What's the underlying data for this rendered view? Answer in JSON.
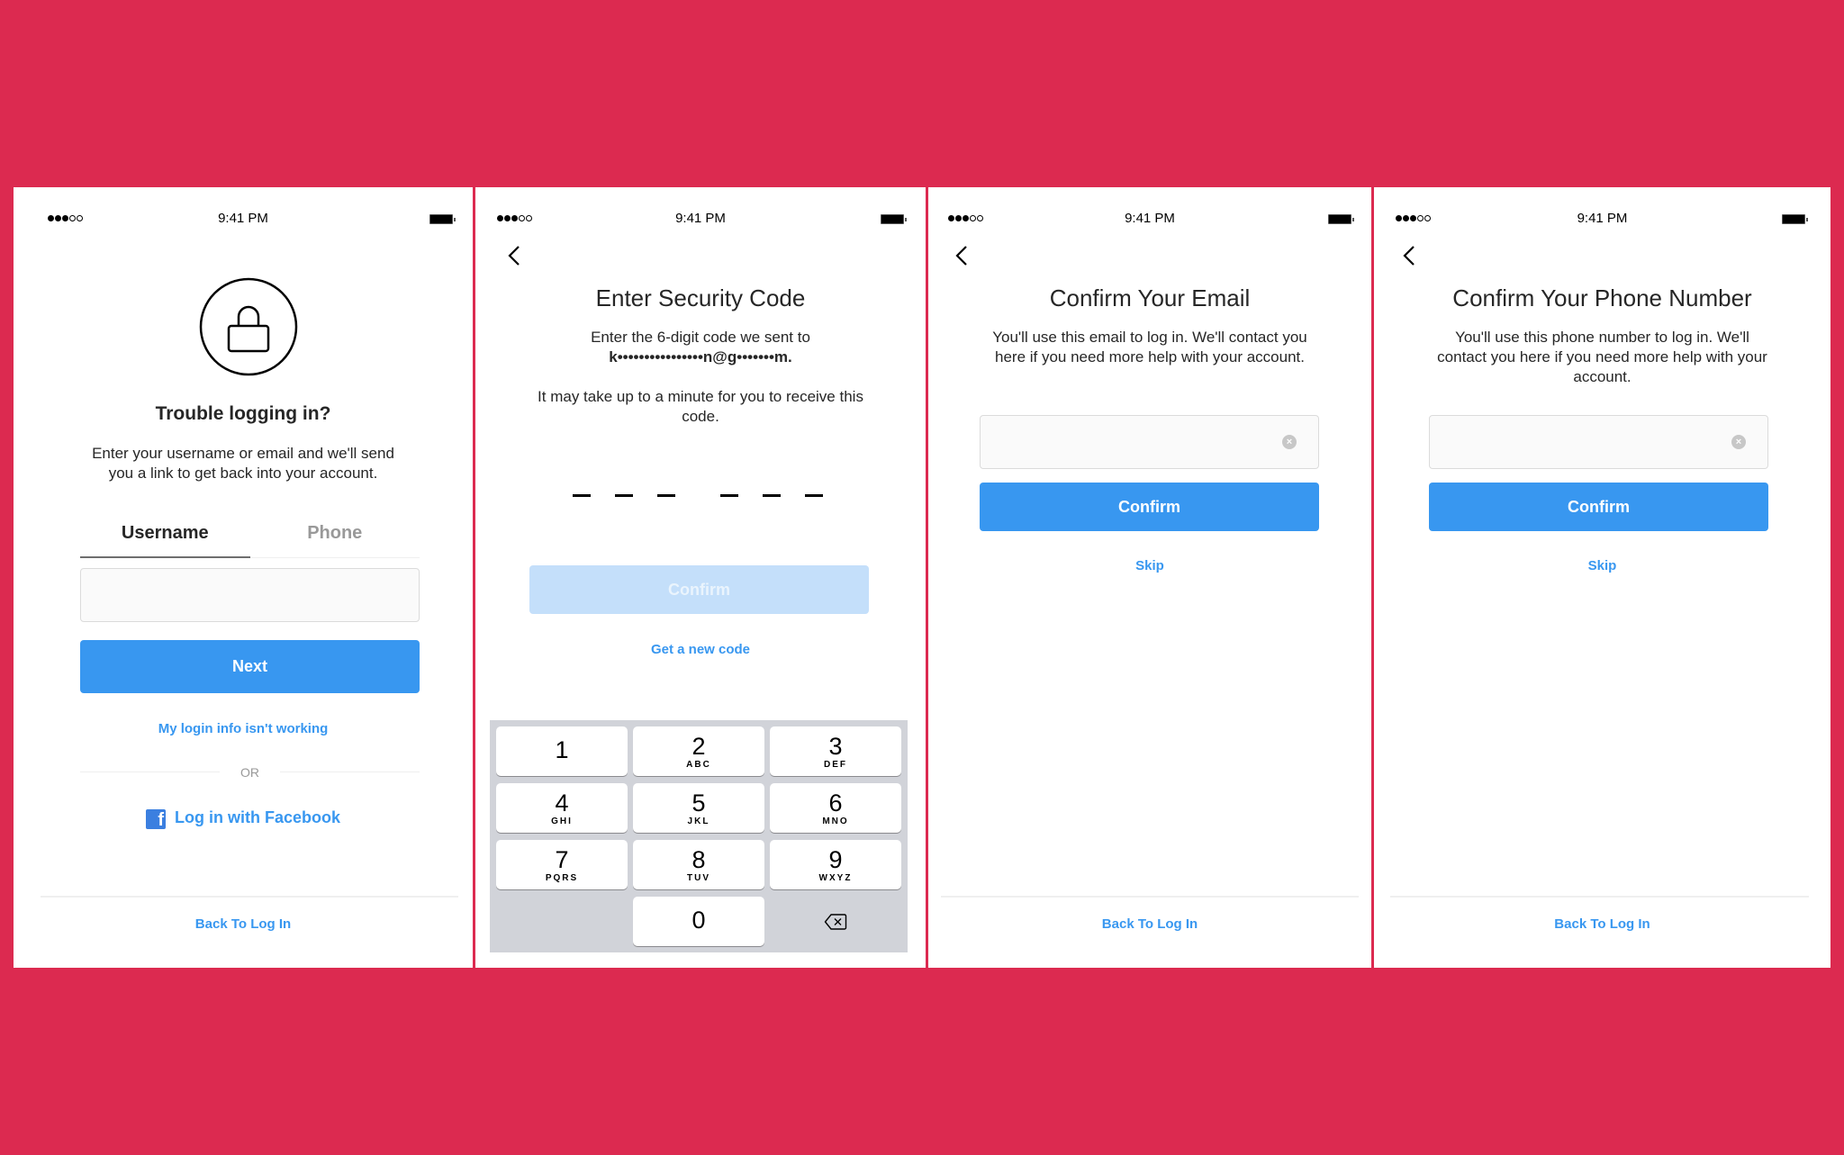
{
  "colors": {
    "background": "#dc2a50",
    "primary_button": "#3897f0",
    "disabled_button": "#c4dffa",
    "link": "#3897f0",
    "facebook": "#3b7fe0"
  },
  "status_bar": {
    "time": "9:41 PM",
    "signal_icon": "signal-dots-icon",
    "battery_icon": "battery-icon"
  },
  "screens": [
    {
      "id": "trouble-logging-in",
      "icon": "lock-icon",
      "title": "Trouble logging in?",
      "description": "Enter your username or email and we'll send you a link to get back into your account.",
      "tabs": [
        {
          "label": "Username",
          "active": true
        },
        {
          "label": "Phone",
          "active": false
        }
      ],
      "input": {
        "value": "",
        "placeholder": ""
      },
      "primary_button": "Next",
      "help_link": "My login info isn't working",
      "divider_text": "OR",
      "facebook_link": "Log in with Facebook",
      "facebook_icon": "f",
      "footer_link": "Back To Log In"
    },
    {
      "id": "enter-security-code",
      "back_icon": "chevron-left-icon",
      "title": "Enter Security Code",
      "description_line1": "Enter the 6-digit code we sent to",
      "masked_email": "k••••••••••••••••n@g•••••••m.",
      "description2": "It may take up to a minute for you to receive this code.",
      "code_length": 6,
      "code_value": "",
      "primary_button": "Confirm",
      "primary_button_enabled": false,
      "secondary_link": "Get a new code",
      "keypad": {
        "keys": [
          {
            "num": "1",
            "letters": ""
          },
          {
            "num": "2",
            "letters": "ABC"
          },
          {
            "num": "3",
            "letters": "DEF"
          },
          {
            "num": "4",
            "letters": "GHI"
          },
          {
            "num": "5",
            "letters": "JKL"
          },
          {
            "num": "6",
            "letters": "MNO"
          },
          {
            "num": "7",
            "letters": "PQRS"
          },
          {
            "num": "8",
            "letters": "TUV"
          },
          {
            "num": "9",
            "letters": "WXYZ"
          },
          {
            "num": "0",
            "letters": ""
          }
        ],
        "delete_icon": "backspace-icon"
      }
    },
    {
      "id": "confirm-email",
      "back_icon": "chevron-left-icon",
      "title": "Confirm Your Email",
      "description": "You'll use this email to log in. We'll contact you here if you need more help with your account.",
      "input": {
        "value": "",
        "placeholder": ""
      },
      "clear_icon": "×",
      "primary_button": "Confirm",
      "secondary_link": "Skip",
      "footer_link": "Back To Log In"
    },
    {
      "id": "confirm-phone",
      "back_icon": "chevron-left-icon",
      "title": "Confirm Your Phone Number",
      "description": "You'll use this phone number to log in. We'll contact you here if you need more help with your account.",
      "input": {
        "value": "",
        "placeholder": ""
      },
      "clear_icon": "×",
      "primary_button": "Confirm",
      "secondary_link": "Skip",
      "footer_link": "Back To Log In"
    }
  ]
}
